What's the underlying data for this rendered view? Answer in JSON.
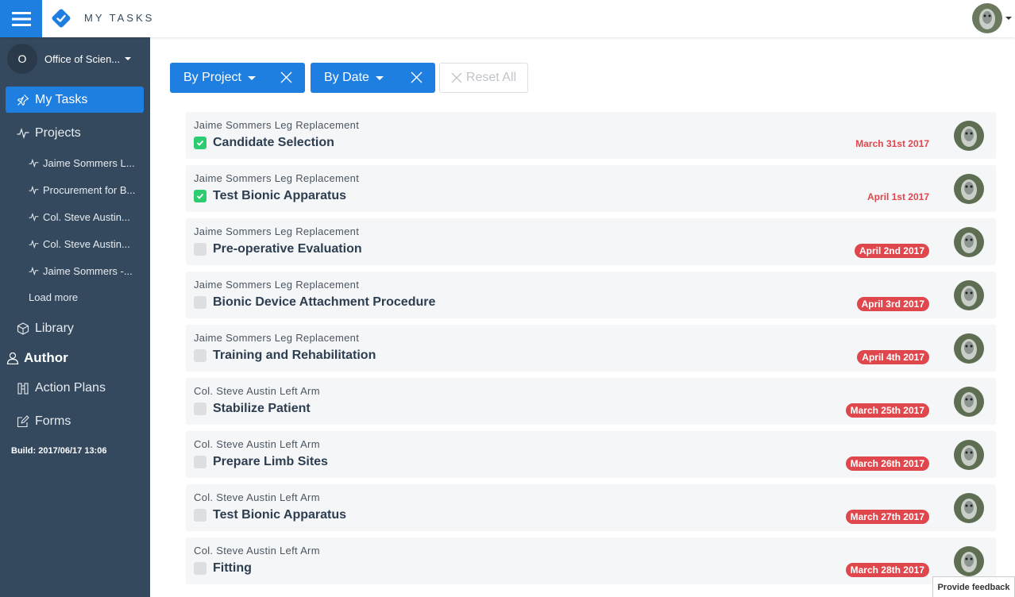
{
  "header": {
    "app_title": "MY TASKS",
    "menu_icon": "hamburger-icon",
    "logo_icon": "checkmark-diamond-logo"
  },
  "colors": {
    "primary": "#1f7fe0",
    "sidebar": "#34495e",
    "overdue": "#e0474c",
    "done": "#2ecc71"
  },
  "sidebar": {
    "org_initial": "O",
    "org_name": "Office of Scien...",
    "my_tasks": "My Tasks",
    "projects": "Projects",
    "project_items": [
      "Jaime Sommers L...",
      "Procurement for B...",
      "Col. Steve Austin...",
      "Col. Steve Austin...",
      "Jaime Sommers -..."
    ],
    "load_more": "Load more",
    "library": "Library",
    "author": "Author",
    "action_plans": "Action Plans",
    "forms": "Forms",
    "build": "Build: 2017/06/17 13:06"
  },
  "filters": {
    "by_project": "By Project",
    "by_date": "By Date",
    "reset_all": "Reset All"
  },
  "tasks": [
    {
      "project": "Jaime Sommers Leg Replacement",
      "title": "Candidate Selection",
      "date": "March 31st 2017",
      "done": true,
      "badge": false
    },
    {
      "project": "Jaime Sommers Leg Replacement",
      "title": "Test Bionic Apparatus",
      "date": "April 1st 2017",
      "done": true,
      "badge": false
    },
    {
      "project": "Jaime Sommers Leg Replacement",
      "title": "Pre-operative Evaluation",
      "date": "April 2nd 2017",
      "done": false,
      "badge": true
    },
    {
      "project": "Jaime Sommers Leg Replacement",
      "title": "Bionic Device Attachment Procedure",
      "date": "April 3rd 2017",
      "done": false,
      "badge": true
    },
    {
      "project": "Jaime Sommers Leg Replacement",
      "title": "Training and Rehabilitation",
      "date": "April 4th 2017",
      "done": false,
      "badge": true
    },
    {
      "project": "Col. Steve Austin Left Arm",
      "title": "Stabilize Patient",
      "date": "March 25th 2017",
      "done": false,
      "badge": true
    },
    {
      "project": "Col. Steve Austin Left Arm",
      "title": "Prepare Limb Sites",
      "date": "March 26th 2017",
      "done": false,
      "badge": true
    },
    {
      "project": "Col. Steve Austin Left Arm",
      "title": "Test Bionic Apparatus",
      "date": "March 27th 2017",
      "done": false,
      "badge": true
    },
    {
      "project": "Col. Steve Austin Left Arm",
      "title": "Fitting",
      "date": "March 28th 2017",
      "done": false,
      "badge": true
    }
  ],
  "feedback": "Provide feedback"
}
